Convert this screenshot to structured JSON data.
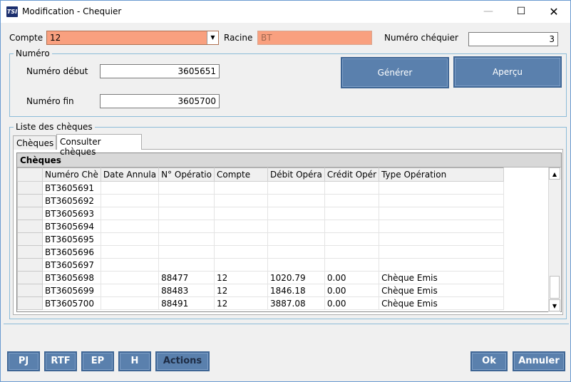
{
  "window": {
    "title": "Modification - Chequier",
    "icon_text": "TSI"
  },
  "form": {
    "compte_label": "Compte",
    "compte_value": "12",
    "racine_label": "Racine",
    "racine_value": "BT",
    "numero_chequier_label": "Numéro chéquier",
    "numero_chequier_value": "3"
  },
  "numero_group": {
    "title": "Numéro",
    "debut_label": "Numéro début",
    "debut_value": "3605651",
    "fin_label": "Numéro fin",
    "fin_value": "3605700",
    "generer_label": "Générer",
    "apercu_label": "Aperçu"
  },
  "liste_group": {
    "title": "Liste des chèques",
    "tabs": [
      {
        "label": "Chèques"
      },
      {
        "label": "Consulter chèques"
      }
    ],
    "grid_caption": "Chèques",
    "columns": [
      "Numéro Chè",
      "Date Annula",
      "N° Opératio",
      "Compte",
      "Débit Opéra",
      "Crédit Opér",
      "Type Opération"
    ],
    "rows": [
      [
        "BT3605691",
        "",
        "",
        "",
        "",
        "",
        ""
      ],
      [
        "BT3605692",
        "",
        "",
        "",
        "",
        "",
        ""
      ],
      [
        "BT3605693",
        "",
        "",
        "",
        "",
        "",
        ""
      ],
      [
        "BT3605694",
        "",
        "",
        "",
        "",
        "",
        ""
      ],
      [
        "BT3605695",
        "",
        "",
        "",
        "",
        "",
        ""
      ],
      [
        "BT3605696",
        "",
        "",
        "",
        "",
        "",
        ""
      ],
      [
        "BT3605697",
        "",
        "",
        "",
        "",
        "",
        ""
      ],
      [
        "BT3605698",
        "",
        "88477",
        "12",
        "1020.79",
        "0.00",
        "Chèque Emis"
      ],
      [
        "BT3605699",
        "",
        "88483",
        "12",
        "1846.18",
        "0.00",
        "Chèque Emis"
      ],
      [
        "BT3605700",
        "",
        "88491",
        "12",
        "3887.08",
        "0.00",
        "Chèque Emis"
      ]
    ]
  },
  "footer": {
    "pj": "PJ",
    "rtf": "RTF",
    "ep": "EP",
    "h": "H",
    "actions": "Actions",
    "ok": "Ok",
    "annuler": "Annuler"
  },
  "colors": {
    "accent_button": "#5a80ad",
    "field_highlight": "#f9a07f",
    "group_border": "#8cbcd8"
  }
}
